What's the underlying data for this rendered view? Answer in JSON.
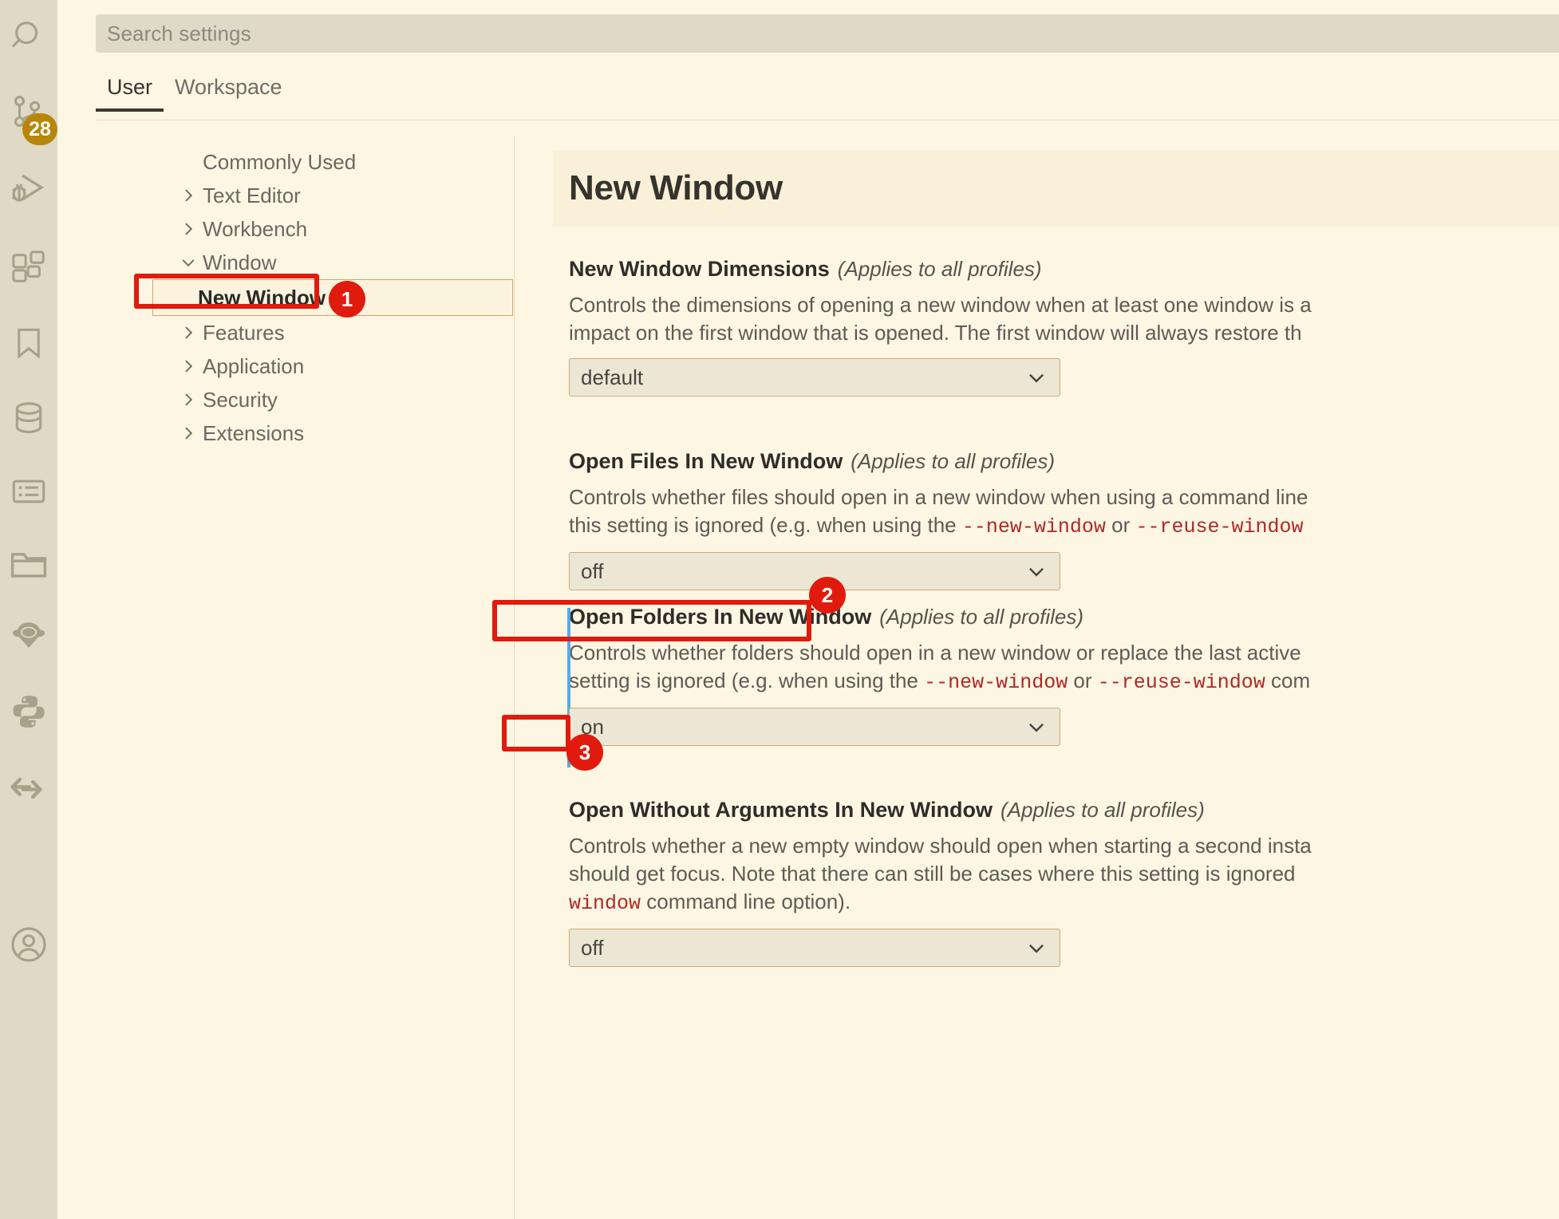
{
  "activity_bar": {
    "icons": [
      {
        "name": "search-icon",
        "label": "Search"
      },
      {
        "name": "source-control-icon",
        "label": "Source Control",
        "badge": "28"
      },
      {
        "name": "run-and-debug-icon",
        "label": "Run and Debug"
      },
      {
        "name": "extensions-icon",
        "label": "Extensions"
      },
      {
        "name": "bookmarks-icon",
        "label": "Bookmarks"
      },
      {
        "name": "database-icon",
        "label": "Database"
      },
      {
        "name": "todo-list-icon",
        "label": "Todo List"
      },
      {
        "name": "project-manager-icon",
        "label": "Project Manager"
      },
      {
        "name": "anaconda-icon",
        "label": "Anaconda"
      },
      {
        "name": "python-icon",
        "label": "Python"
      },
      {
        "name": "live-share-icon",
        "label": "Live Share"
      },
      {
        "name": "account-icon",
        "label": "Accounts"
      }
    ],
    "badge_count": "28"
  },
  "search": {
    "placeholder": "Search settings",
    "value": ""
  },
  "tabs": [
    {
      "label": "User",
      "active": true
    },
    {
      "label": "Workspace",
      "active": false
    }
  ],
  "toc": {
    "items": [
      {
        "label": "Commonly Used",
        "expandable": false,
        "expanded": false,
        "child": false,
        "selected": false
      },
      {
        "label": "Text Editor",
        "expandable": true,
        "expanded": false,
        "child": false,
        "selected": false
      },
      {
        "label": "Workbench",
        "expandable": true,
        "expanded": false,
        "child": false,
        "selected": false
      },
      {
        "label": "Window",
        "expandable": true,
        "expanded": true,
        "child": false,
        "selected": false
      },
      {
        "label": "New Window",
        "expandable": false,
        "expanded": false,
        "child": true,
        "selected": true
      },
      {
        "label": "Features",
        "expandable": true,
        "expanded": false,
        "child": false,
        "selected": false
      },
      {
        "label": "Application",
        "expandable": true,
        "expanded": false,
        "child": false,
        "selected": false
      },
      {
        "label": "Security",
        "expandable": true,
        "expanded": false,
        "child": false,
        "selected": false
      },
      {
        "label": "Extensions",
        "expandable": true,
        "expanded": false,
        "child": false,
        "selected": false
      }
    ]
  },
  "settings_pane": {
    "header_title": "New Window",
    "settings": [
      {
        "title": "New Window Dimensions",
        "profiles_note": "(Applies to all profiles)",
        "desc_line1_a": "Controls the dimensions of opening a new window when at least one window is a",
        "desc_line2_a": "impact on the first window that is opened. The first window will always restore th",
        "value": "default",
        "modified": false
      },
      {
        "title": "Open Files In New Window",
        "profiles_note": "(Applies to all profiles)",
        "desc_line1_a": "Controls whether files should open in a new window when using a command line",
        "desc_line2_a": "this setting is ignored (e.g. when using the ",
        "desc_line2_code1": "--new-window",
        "desc_line2_b": " or ",
        "desc_line2_code2": "--reuse-window",
        "value": "off",
        "modified": false
      },
      {
        "title": "Open Folders In New Window",
        "profiles_note": "(Applies to all profiles)",
        "desc_line1_a": "Controls whether folders should open in a new window or replace the last active",
        "desc_line2_a": "setting is ignored (e.g. when using the ",
        "desc_line2_code1": "--new-window",
        "desc_line2_b": " or ",
        "desc_line2_code2": "--reuse-window",
        "desc_line2_c": " com",
        "value": "on",
        "modified": true
      },
      {
        "title": "Open Without Arguments In New Window",
        "profiles_note": "(Applies to all profiles)",
        "desc_line1_a": "Controls whether a new empty window should open when starting a second insta",
        "desc_line2_a": "should get focus. Note that there can still be cases where this setting is ignored",
        "desc_line3_code": "window",
        "desc_line3_b": " command line option).",
        "value": "off",
        "modified": false
      }
    ]
  },
  "annotations": [
    {
      "number": "1",
      "target": "toc-item-new-window"
    },
    {
      "number": "2",
      "target": "setting-title-open-folders-in-new-window"
    },
    {
      "number": "3",
      "target": "setting-select-open-folders-in-new-window"
    }
  ],
  "colors": {
    "accent_red": "#e01b0e",
    "badge_gold": "#b8860b",
    "modified_blue": "#5aa9e6",
    "code_red": "#b02828",
    "page_bg": "#fdf6e3",
    "activity_bg": "#dedac5"
  }
}
